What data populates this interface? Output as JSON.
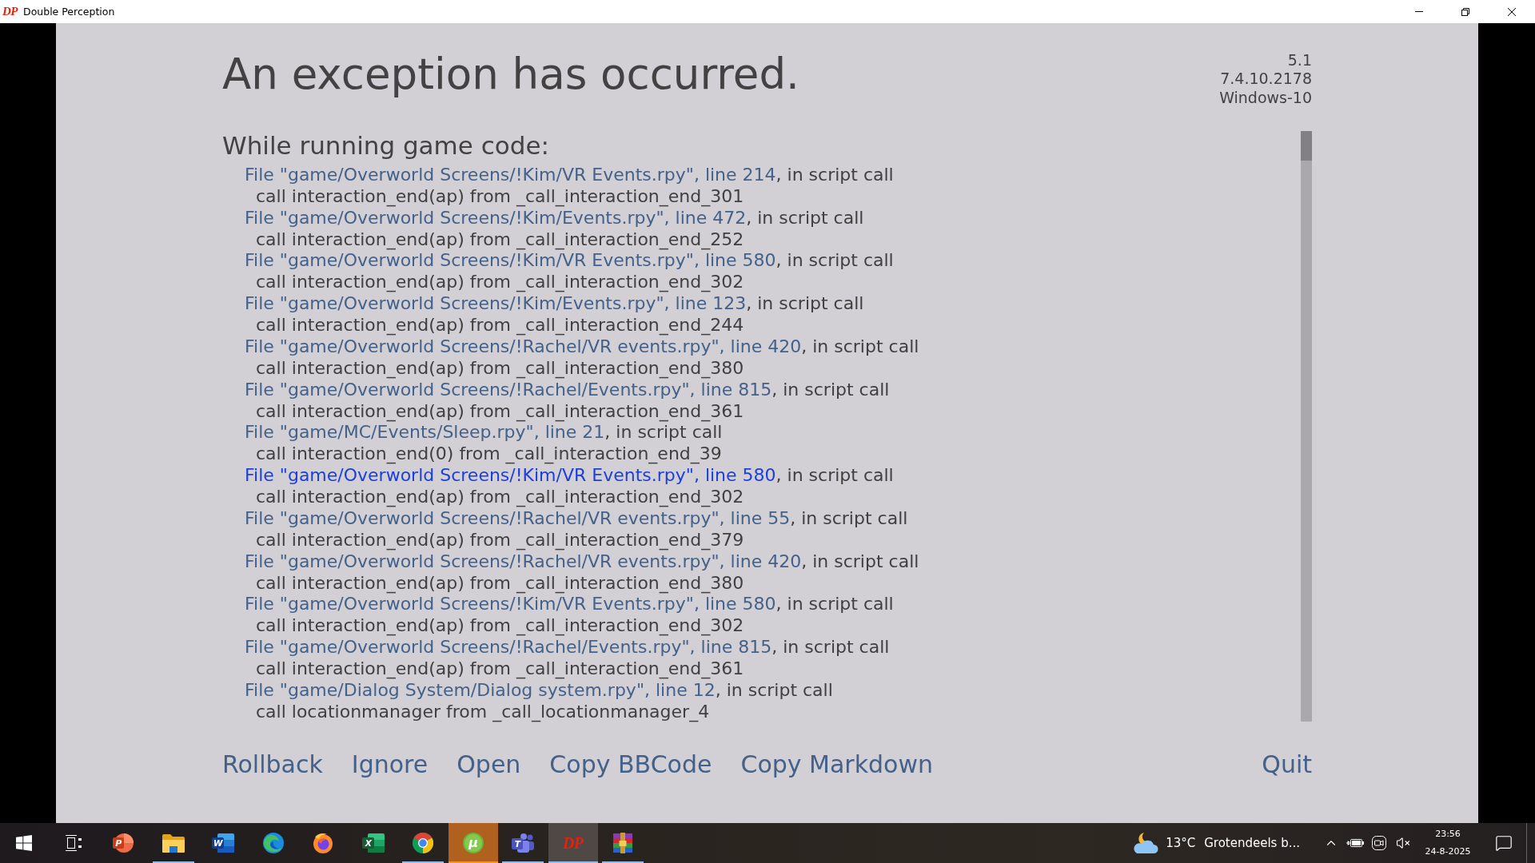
{
  "window": {
    "logo": "DP",
    "title": "Double Perception"
  },
  "exception": {
    "title": "An exception has occurred.",
    "version_info": [
      "5.1",
      "7.4.10.2178",
      "Windows-10"
    ],
    "section_title": "While running game code:",
    "traceback": [
      {
        "file_link": "File \"game/Overworld Screens/!Kim/VR Events.rpy\", line 214",
        "context": ", in script call",
        "code": "call interaction_end(ap) from _call_interaction_end_301",
        "hovered": false
      },
      {
        "file_link": "File \"game/Overworld Screens/!Kim/Events.rpy\", line 472",
        "context": ", in script call",
        "code": "call interaction_end(ap) from _call_interaction_end_252",
        "hovered": false
      },
      {
        "file_link": "File \"game/Overworld Screens/!Kim/VR Events.rpy\", line 580",
        "context": ", in script call",
        "code": "call interaction_end(ap) from _call_interaction_end_302",
        "hovered": false
      },
      {
        "file_link": "File \"game/Overworld Screens/!Kim/Events.rpy\", line 123",
        "context": ", in script call",
        "code": "call interaction_end(ap) from _call_interaction_end_244",
        "hovered": false
      },
      {
        "file_link": "File \"game/Overworld Screens/!Rachel/VR events.rpy\", line 420",
        "context": ", in script call",
        "code": "call interaction_end(ap) from _call_interaction_end_380",
        "hovered": false
      },
      {
        "file_link": "File \"game/Overworld Screens/!Rachel/Events.rpy\", line 815",
        "context": ", in script call",
        "code": "call interaction_end(ap) from _call_interaction_end_361",
        "hovered": false
      },
      {
        "file_link": "File \"game/MC/Events/Sleep.rpy\", line 21",
        "context": ", in script call",
        "code": "call interaction_end(0) from _call_interaction_end_39",
        "hovered": false
      },
      {
        "file_link": "File \"game/Overworld Screens/!Kim/VR Events.rpy\", line 580",
        "context": ", in script call",
        "code": "call interaction_end(ap) from _call_interaction_end_302",
        "hovered": true
      },
      {
        "file_link": "File \"game/Overworld Screens/!Rachel/VR events.rpy\", line 55",
        "context": ", in script call",
        "code": "call interaction_end(ap) from _call_interaction_end_379",
        "hovered": false
      },
      {
        "file_link": "File \"game/Overworld Screens/!Rachel/VR events.rpy\", line 420",
        "context": ", in script call",
        "code": "call interaction_end(ap) from _call_interaction_end_380",
        "hovered": false
      },
      {
        "file_link": "File \"game/Overworld Screens/!Kim/VR Events.rpy\", line 580",
        "context": ", in script call",
        "code": "call interaction_end(ap) from _call_interaction_end_302",
        "hovered": false
      },
      {
        "file_link": "File \"game/Overworld Screens/!Rachel/Events.rpy\", line 815",
        "context": ", in script call",
        "code": "call interaction_end(ap) from _call_interaction_end_361",
        "hovered": false
      },
      {
        "file_link": "File \"game/Dialog System/Dialog system.rpy\", line 12",
        "context": ", in script call",
        "code": "call locationmanager from _call_locationmanager_4",
        "hovered": false
      }
    ]
  },
  "actions": [
    {
      "label": "Rollback"
    },
    {
      "label": "Ignore"
    },
    {
      "label": "Open"
    },
    {
      "label": "Copy BBCode"
    },
    {
      "label": "Copy Markdown"
    }
  ],
  "quit": {
    "label": "Quit"
  },
  "taskbar": {
    "apps": [
      {
        "kind": "powerpoint",
        "letter": "P",
        "running": false,
        "selected": false,
        "flashing": false
      },
      {
        "kind": "explorer",
        "running": true,
        "selected": false,
        "flashing": false
      },
      {
        "kind": "word",
        "letter": "W",
        "running": false,
        "selected": false,
        "flashing": false
      },
      {
        "kind": "edge",
        "running": false,
        "selected": false,
        "flashing": false
      },
      {
        "kind": "firefox",
        "running": false,
        "selected": false,
        "flashing": false
      },
      {
        "kind": "excel",
        "letter": "X",
        "running": false,
        "selected": false,
        "flashing": false
      },
      {
        "kind": "chrome",
        "running": true,
        "selected": false,
        "flashing": false
      },
      {
        "kind": "utorrent",
        "letter": "µ",
        "running": true,
        "selected": false,
        "flashing": true
      },
      {
        "kind": "teams",
        "letter": "T",
        "running": true,
        "selected": false,
        "flashing": false
      },
      {
        "kind": "dp",
        "letter": "DP",
        "running": true,
        "selected": true,
        "flashing": false
      },
      {
        "kind": "winrar",
        "running": true,
        "selected": false,
        "flashing": false
      }
    ],
    "weather": {
      "temperature": "13°C",
      "condition": "Grotendeels b..."
    },
    "clock": {
      "time": "23:56",
      "date": "24-8-2025"
    }
  }
}
